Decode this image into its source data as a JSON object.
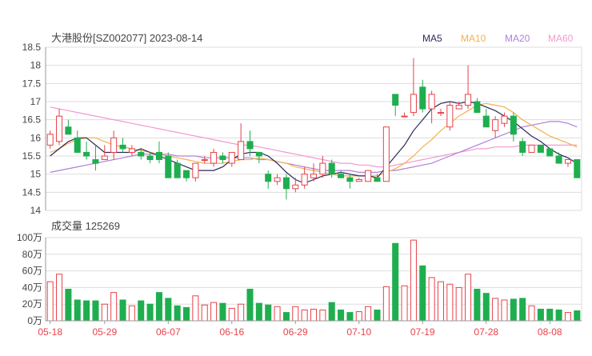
{
  "header": {
    "title": "大港股份[SZ002077] 2023-08-14",
    "legend": [
      {
        "label": "MA5",
        "color": "#2b2a5c"
      },
      {
        "label": "MA10",
        "color": "#f5b04c"
      },
      {
        "label": "MA20",
        "color": "#b27fdc"
      },
      {
        "label": "MA60",
        "color": "#f29ad0"
      }
    ]
  },
  "colors": {
    "up": "#e8424a",
    "down": "#1fae4f",
    "grid": "#dddddd",
    "axis": "#999999"
  },
  "chart_data": [
    {
      "type": "candlestick",
      "title": "大港股份[SZ002077] 2023-08-14",
      "ylim": [
        14,
        18.5
      ],
      "ytick_labels": [
        "18.5",
        "18",
        "17.5",
        "17",
        "16.5",
        "16",
        "15.5",
        "15",
        "14.5",
        "14"
      ],
      "xtick_labels": [
        {
          "label": "05-18",
          "index": 0
        },
        {
          "label": "05-29",
          "index": 6
        },
        {
          "label": "06-07",
          "index": 13
        },
        {
          "label": "06-16",
          "index": 20
        },
        {
          "label": "06-29",
          "index": 27
        },
        {
          "label": "07-10",
          "index": 34
        },
        {
          "label": "07-19",
          "index": 41
        },
        {
          "label": "07-28",
          "index": 48
        },
        {
          "label": "08-08",
          "index": 55
        }
      ],
      "ohlc": [
        [
          15.8,
          16.2,
          15.7,
          16.1
        ],
        [
          15.9,
          16.8,
          15.8,
          16.6
        ],
        [
          16.3,
          16.5,
          16.1,
          16.1
        ],
        [
          16.0,
          16.2,
          15.6,
          15.6
        ],
        [
          15.6,
          15.9,
          15.4,
          15.5
        ],
        [
          15.4,
          15.8,
          15.1,
          15.3
        ],
        [
          15.4,
          15.8,
          15.4,
          15.5
        ],
        [
          15.6,
          16.2,
          15.4,
          16.0
        ],
        [
          15.8,
          16.0,
          15.6,
          15.7
        ],
        [
          15.6,
          15.8,
          15.5,
          15.7
        ],
        [
          15.6,
          15.7,
          15.4,
          15.5
        ],
        [
          15.5,
          15.6,
          15.3,
          15.4
        ],
        [
          15.6,
          15.9,
          15.3,
          15.4
        ],
        [
          15.5,
          15.6,
          14.9,
          14.9
        ],
        [
          15.3,
          15.4,
          14.9,
          14.9
        ],
        [
          15.1,
          15.1,
          14.8,
          14.9
        ],
        [
          14.9,
          15.3,
          14.8,
          15.3
        ],
        [
          15.4,
          15.5,
          15.3,
          15.4
        ],
        [
          15.3,
          15.7,
          15.2,
          15.6
        ],
        [
          15.5,
          15.6,
          15.3,
          15.4
        ],
        [
          15.3,
          15.6,
          15.2,
          15.6
        ],
        [
          15.4,
          16.4,
          15.4,
          15.9
        ],
        [
          15.9,
          16.2,
          15.5,
          15.7
        ],
        [
          15.6,
          15.6,
          15.3,
          15.5
        ],
        [
          15.0,
          15.1,
          14.6,
          14.8
        ],
        [
          14.8,
          15.0,
          14.7,
          14.9
        ],
        [
          14.9,
          15.0,
          14.3,
          14.6
        ],
        [
          14.6,
          14.9,
          14.5,
          14.7
        ],
        [
          14.7,
          15.2,
          14.6,
          15.0
        ],
        [
          14.9,
          15.3,
          14.8,
          15.0
        ],
        [
          15.0,
          15.5,
          14.9,
          15.3
        ],
        [
          15.3,
          15.4,
          14.9,
          15.0
        ],
        [
          15.0,
          15.1,
          14.9,
          14.9
        ],
        [
          14.9,
          15.0,
          14.6,
          14.8
        ],
        [
          14.8,
          14.9,
          14.8,
          14.85
        ],
        [
          14.8,
          15.1,
          14.8,
          15.1
        ],
        [
          14.9,
          15.0,
          14.8,
          14.8
        ],
        [
          14.8,
          16.3,
          14.8,
          16.3
        ],
        [
          17.2,
          17.2,
          16.6,
          16.9
        ],
        [
          16.6,
          16.7,
          16.6,
          16.6
        ],
        [
          16.7,
          18.2,
          16.6,
          17.2
        ],
        [
          17.4,
          17.6,
          16.7,
          16.8
        ],
        [
          16.8,
          17.3,
          16.4,
          17.2
        ],
        [
          16.7,
          16.8,
          16.6,
          16.7
        ],
        [
          16.3,
          17.0,
          16.2,
          16.9
        ],
        [
          16.8,
          17.0,
          16.8,
          16.9
        ],
        [
          16.9,
          18.0,
          16.8,
          17.2
        ],
        [
          17.0,
          17.1,
          16.7,
          16.7
        ],
        [
          16.6,
          16.8,
          16.3,
          16.3
        ],
        [
          16.2,
          16.6,
          16.0,
          16.5
        ],
        [
          16.4,
          16.7,
          16.3,
          16.6
        ],
        [
          16.6,
          16.7,
          15.9,
          16.1
        ],
        [
          15.9,
          16.0,
          15.5,
          15.6
        ],
        [
          15.6,
          15.8,
          15.6,
          15.8
        ],
        [
          15.8,
          15.8,
          15.6,
          15.6
        ],
        [
          15.7,
          15.7,
          15.5,
          15.5
        ],
        [
          15.5,
          15.6,
          15.3,
          15.3
        ],
        [
          15.3,
          15.4,
          15.2,
          15.4
        ],
        [
          15.4,
          15.4,
          14.9,
          14.9
        ]
      ],
      "ma5": [
        15.5,
        15.7,
        15.9,
        16.0,
        16.0,
        15.8,
        15.6,
        15.6,
        15.6,
        15.6,
        15.7,
        15.6,
        15.5,
        15.4,
        15.3,
        15.2,
        15.1,
        15.1,
        15.1,
        15.2,
        15.4,
        15.55,
        15.6,
        15.6,
        15.5,
        15.3,
        15.05,
        14.85,
        14.75,
        14.85,
        14.95,
        15.0,
        15.05,
        15.0,
        14.95,
        14.95,
        14.9,
        15.2,
        15.5,
        15.8,
        16.2,
        16.5,
        16.8,
        16.95,
        17.0,
        16.95,
        17.0,
        16.95,
        16.85,
        16.75,
        16.6,
        16.45,
        16.25,
        16.05,
        15.9,
        15.7,
        15.55,
        15.45,
        15.3
      ],
      "ma10": [
        15.6,
        15.7,
        15.85,
        15.95,
        16.0,
        16.0,
        15.9,
        15.8,
        15.75,
        15.7,
        15.65,
        15.6,
        15.55,
        15.5,
        15.45,
        15.4,
        15.35,
        15.3,
        15.3,
        15.3,
        15.35,
        15.4,
        15.4,
        15.45,
        15.4,
        15.35,
        15.3,
        15.2,
        15.15,
        15.1,
        15.05,
        15.0,
        14.95,
        14.95,
        14.95,
        14.95,
        14.95,
        15.05,
        15.15,
        15.3,
        15.5,
        15.75,
        15.95,
        16.2,
        16.4,
        16.6,
        16.75,
        16.9,
        16.95,
        16.9,
        16.85,
        16.7,
        16.5,
        16.35,
        16.2,
        16.05,
        15.95,
        15.85,
        15.75
      ],
      "ma20": [
        15.05,
        15.1,
        15.15,
        15.2,
        15.25,
        15.3,
        15.35,
        15.4,
        15.45,
        15.5,
        15.55,
        15.55,
        15.55,
        15.55,
        15.5,
        15.5,
        15.5,
        15.45,
        15.45,
        15.45,
        15.45,
        15.45,
        15.45,
        15.4,
        15.4,
        15.35,
        15.3,
        15.25,
        15.2,
        15.15,
        15.1,
        15.1,
        15.1,
        15.1,
        15.05,
        15.05,
        15.05,
        15.1,
        15.1,
        15.15,
        15.2,
        15.25,
        15.3,
        15.4,
        15.5,
        15.6,
        15.7,
        15.8,
        15.9,
        16.0,
        16.1,
        16.2,
        16.3,
        16.35,
        16.4,
        16.45,
        16.45,
        16.4,
        16.3
      ],
      "ma60": [
        16.85,
        16.8,
        16.75,
        16.7,
        16.65,
        16.6,
        16.55,
        16.5,
        16.45,
        16.4,
        16.35,
        16.3,
        16.25,
        16.2,
        16.15,
        16.1,
        16.05,
        16.0,
        15.95,
        15.9,
        15.85,
        15.8,
        15.8,
        15.75,
        15.7,
        15.65,
        15.6,
        15.55,
        15.5,
        15.45,
        15.4,
        15.35,
        15.3,
        15.3,
        15.25,
        15.25,
        15.2,
        15.2,
        15.25,
        15.3,
        15.35,
        15.4,
        15.45,
        15.5,
        15.55,
        15.6,
        15.65,
        15.7,
        15.7,
        15.75,
        15.75,
        15.75,
        15.8,
        15.8,
        15.8,
        15.8,
        15.8,
        15.8,
        15.8
      ]
    },
    {
      "type": "bar",
      "title": "成交量 125269",
      "ylim": [
        0,
        100
      ],
      "ytick_labels": [
        "100万",
        "80万",
        "60万",
        "40万",
        "20万",
        "0万"
      ],
      "volume": [
        47,
        56,
        38,
        25,
        24,
        24,
        20,
        34,
        25,
        18,
        24,
        20,
        34,
        27,
        18,
        16,
        30,
        19,
        22,
        21,
        15,
        20,
        38,
        21,
        19,
        17,
        10,
        17,
        13,
        14,
        13,
        22,
        13,
        10,
        11,
        17,
        13,
        41,
        93,
        42,
        97,
        66,
        52,
        47,
        44,
        40,
        56,
        38,
        33,
        27,
        25,
        26,
        27,
        18,
        14,
        14,
        13,
        10,
        12
      ]
    }
  ],
  "volume_title": "成交量 125269"
}
